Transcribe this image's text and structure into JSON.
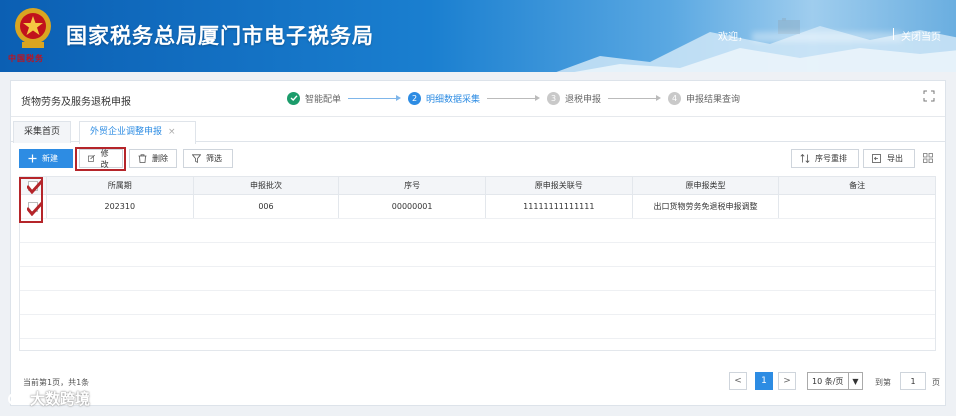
{
  "header": {
    "site_title": "国家税务总局厦门市电子税务局",
    "emblem_text": "中国税务",
    "welcome": "欢迎，",
    "close_page": "关闭当页"
  },
  "panel": {
    "title": "货物劳务及服务退税申报",
    "steps": [
      {
        "num": "",
        "label": "智能配单",
        "state": "done"
      },
      {
        "num": "2",
        "label": "明细数据采集",
        "state": "active"
      },
      {
        "num": "3",
        "label": "退税申报",
        "state": "pending"
      },
      {
        "num": "4",
        "label": "申报结果查询",
        "state": "pending"
      }
    ]
  },
  "tabs": [
    {
      "label": "采集首页"
    },
    {
      "label": "外贸企业调整申报",
      "close": "×"
    }
  ],
  "toolbar": {
    "new": "新建",
    "edit": "修改",
    "delete": "删除",
    "filter": "筛选",
    "reorder": "序号重排",
    "export": "导出"
  },
  "table": {
    "columns": [
      "所属期",
      "申报批次",
      "序号",
      "原申报关联号",
      "原申报类型",
      "备注"
    ],
    "rows": [
      [
        "202310",
        "006",
        "00000001",
        "11111111111111",
        "出口货物劳务免退税申报调整",
        ""
      ]
    ]
  },
  "pagination": {
    "info": "当前第1页，共1条",
    "prev": "<",
    "current": "1",
    "next": ">",
    "page_size": "10 条/页",
    "goto_label": "到第",
    "goto_value": "1",
    "page_unit": "页"
  },
  "watermark": "大数跨境",
  "colors": {
    "accent": "#2d8ce3",
    "done": "#1c9c6b",
    "highlight": "#b5252a"
  }
}
